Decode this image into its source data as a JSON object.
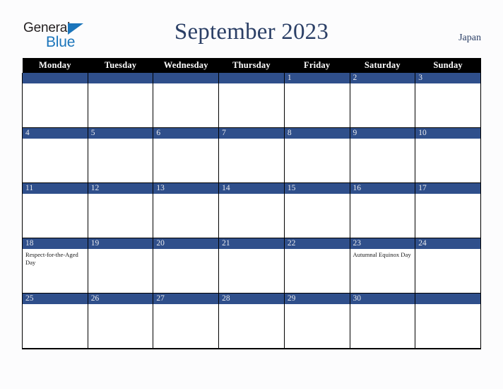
{
  "brand": {
    "name_part1": "General",
    "name_part2": "Blue",
    "triangle_color": "#1b75bb"
  },
  "header": {
    "title": "September 2023",
    "country": "Japan"
  },
  "theme": {
    "header_row_bg": "#000000",
    "day_number_bg": "#2f4f8b",
    "day_number_color": "#e8eaef",
    "title_color": "#2b3f66",
    "page_bg": "#fcfcfd",
    "cell_bg": "#ffffff",
    "border_color": "#000000"
  },
  "weekdays": [
    "Monday",
    "Tuesday",
    "Wednesday",
    "Thursday",
    "Friday",
    "Saturday",
    "Sunday"
  ],
  "weeks": [
    [
      {
        "day": "",
        "event": ""
      },
      {
        "day": "",
        "event": ""
      },
      {
        "day": "",
        "event": ""
      },
      {
        "day": "",
        "event": ""
      },
      {
        "day": "1",
        "event": ""
      },
      {
        "day": "2",
        "event": ""
      },
      {
        "day": "3",
        "event": ""
      }
    ],
    [
      {
        "day": "4",
        "event": ""
      },
      {
        "day": "5",
        "event": ""
      },
      {
        "day": "6",
        "event": ""
      },
      {
        "day": "7",
        "event": ""
      },
      {
        "day": "8",
        "event": ""
      },
      {
        "day": "9",
        "event": ""
      },
      {
        "day": "10",
        "event": ""
      }
    ],
    [
      {
        "day": "11",
        "event": ""
      },
      {
        "day": "12",
        "event": ""
      },
      {
        "day": "13",
        "event": ""
      },
      {
        "day": "14",
        "event": ""
      },
      {
        "day": "15",
        "event": ""
      },
      {
        "day": "16",
        "event": ""
      },
      {
        "day": "17",
        "event": ""
      }
    ],
    [
      {
        "day": "18",
        "event": "Respect-for-the-Aged Day"
      },
      {
        "day": "19",
        "event": ""
      },
      {
        "day": "20",
        "event": ""
      },
      {
        "day": "21",
        "event": ""
      },
      {
        "day": "22",
        "event": ""
      },
      {
        "day": "23",
        "event": "Autumnal Equinox Day"
      },
      {
        "day": "24",
        "event": ""
      }
    ],
    [
      {
        "day": "25",
        "event": ""
      },
      {
        "day": "26",
        "event": ""
      },
      {
        "day": "27",
        "event": ""
      },
      {
        "day": "28",
        "event": ""
      },
      {
        "day": "29",
        "event": ""
      },
      {
        "day": "30",
        "event": ""
      },
      {
        "day": "",
        "event": ""
      }
    ]
  ]
}
